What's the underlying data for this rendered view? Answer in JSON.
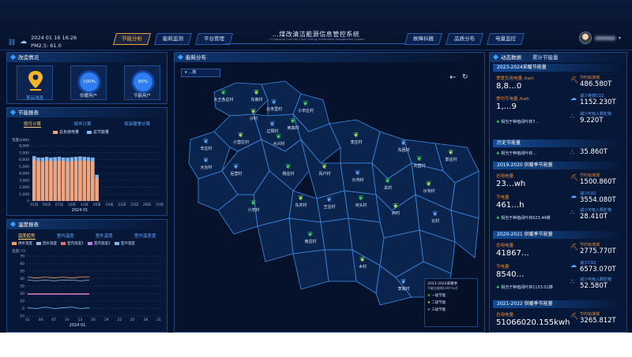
{
  "header": {
    "title": "…煤改清洁能源信息管控系统",
    "subtitle": "…t Changing Coal into Clean Energy Information Management System",
    "datetime": "2024 01 16 16:26",
    "pm25": "PM2.5: 61.0",
    "nav_left": [
      "节能分析",
      "能耗监测",
      "平台管理"
    ],
    "nav_right": [
      "故障抖搬",
      "品质分布",
      "电量监控"
    ],
    "active_nav": "节能分析"
  },
  "panels": {
    "reform": {
      "title": "改造情况",
      "tiles": [
        {
          "label": "首云改造",
          "value": ""
        },
        {
          "label": "供暖用户",
          "value": "100%"
        },
        {
          "label": "节能用户",
          "value": "80%"
        }
      ]
    },
    "energy_report": {
      "title": "节能报表",
      "tabs": [
        "按月计算",
        "按年计算",
        "按采暖季计算"
      ],
      "legend": [
        "总负荷电量",
        "总节能量"
      ],
      "ylabel": "电量(kWh)",
      "x_caption": "2024 01"
    },
    "temp_report": {
      "title": "温度报表",
      "tabs": [
        "温度趋势",
        "室内温度",
        "室外温度",
        "室内温差度"
      ],
      "legend": [
        "供水温度",
        "回水温度",
        "室内温度1",
        "室内温度2",
        "室外温度"
      ],
      "ylabel": "温度(℃)",
      "x_caption": "2024 01"
    },
    "map": {
      "title": "能耗分布",
      "select_label": "…煤",
      "legend_title": "2023-2024采暖季",
      "legend_subtitle": "节能总能耗(kW·h/㎡)",
      "legend_items": [
        "一级节能",
        "二级节能",
        "三级节能"
      ],
      "villages": [
        "大王各庄村",
        "东南村",
        "北寺里村",
        "小辛庄村",
        "沙村",
        "辽阳村",
        "西高村",
        "小营庄村",
        "辛庄村",
        "大兴村",
        "李庄村",
        "东团村",
        "刘营村",
        "郭庄村",
        "后营村",
        "杨庄村",
        "百户村",
        "沙鸿村",
        "关村",
        "沙沟村",
        "大台村",
        "小辛村",
        "东井村",
        "王庄村",
        "河头村",
        "西村",
        "北村",
        "南庄村",
        "木村",
        "李家村"
      ]
    },
    "right": {
      "tabs": [
        "动态数据",
        "累计节能量"
      ],
      "sections": [
        {
          "title": "2023-2024采暖节能量",
          "lines": [
            {
              "label": "季度负用电量 /kwh",
              "value": "8,8…0"
            },
            {
              "label": "季均节电量 /kwh",
              "value": "1,…9"
            }
          ],
          "tree_text": "相当于种植阔叶林7…",
          "right_items": [
            {
              "label": "节约标准煤",
              "value": "486.580T"
            },
            {
              "label": "减少排放CO2",
              "value": "1152.230T"
            },
            {
              "label": "减少可吸入颗粒物",
              "value": "9.220T"
            }
          ]
        },
        {
          "title": "历史节能量",
          "lines": [],
          "tree_text": "相当于种植阔叶林…",
          "right_items": [
            {
              "label": "",
              "value": "35.860T"
            }
          ]
        },
        {
          "title": "2019-2020 供暖季节能量",
          "lines": [
            {
              "label": "总用电量",
              "value": "23…wh"
            },
            {
              "label": "节电量",
              "value": "461…h"
            }
          ],
          "tree_text": "相当于种植阔叶林623.44棵",
          "right_items": [
            {
              "label": "节约标准煤",
              "value": "1500.860T"
            },
            {
              "label": "减少CO2",
              "value": "3554.080T"
            },
            {
              "label": "减少可吸入颗粒物",
              "value": "28.410T"
            }
          ]
        },
        {
          "title": "2020-2021 供暖季节能量",
          "lines": [
            {
              "label": "总用电量",
              "value": "41867…"
            },
            {
              "label": "节电量",
              "value": "8540…"
            }
          ],
          "tree_text": "相当于种植阔叶林1153.01棵",
          "right_items": [
            {
              "label": "节约标准煤",
              "value": "2775.770T"
            },
            {
              "label": "减少CO2",
              "value": "6573.070T"
            },
            {
              "label": "减少可吸入颗粒物",
              "value": "52.580T"
            }
          ]
        },
        {
          "title": "2021-2022 供暖季节能量",
          "lines": [
            {
              "label": "总用电量",
              "value": "51066020.155kwh"
            }
          ],
          "tree_text": "",
          "right_items": [
            {
              "label": "节约标准煤",
              "value": "3265.812T"
            }
          ]
        }
      ]
    }
  },
  "colors": {
    "accent": "#f0b24a",
    "primary": "#37a0ff",
    "orange": "#e58a3a",
    "bar_total": "#f2a57c",
    "bar_save": "#7fb7ef",
    "background": "#06122b"
  },
  "chart_data": [
    {
      "type": "bar",
      "title": "节能报表",
      "ylabel": "电量(kWh)",
      "categories": [
        "01",
        "02",
        "03",
        "04",
        "05",
        "06",
        "07",
        "08",
        "09",
        "10",
        "11",
        "12",
        "13",
        "14",
        "15",
        "16"
      ],
      "series": [
        {
          "name": "总负荷电量",
          "values": [
            6000,
            5800,
            5700,
            5900,
            5800,
            5750,
            5850,
            5800,
            5700,
            5750,
            5800,
            5900,
            5850,
            5800,
            5700,
            3400
          ]
        },
        {
          "name": "总节能量",
          "values": [
            6500,
            6300,
            6300,
            6400,
            6300,
            6350,
            6400,
            6300,
            6300,
            6350,
            6400,
            6450,
            6400,
            6350,
            6300,
            3800
          ]
        }
      ],
      "xticks": [
        "01日",
        "04日",
        "07日",
        "10日",
        "13日",
        "16日",
        "19日",
        "22日",
        "25日",
        "28日",
        "31日"
      ],
      "ylim": [
        0,
        8000
      ],
      "yticks": [
        "8,000",
        "7,000",
        "6,000",
        "5,000",
        "4,000",
        "3,000",
        "2,000",
        "1,000",
        "0"
      ],
      "grid": true
    },
    {
      "type": "line",
      "title": "温度报表",
      "ylabel": "温度(℃)",
      "xticks": [
        "01",
        "04",
        "07",
        "10",
        "13",
        "16",
        "19",
        "22",
        "25",
        "28",
        "31"
      ],
      "yticks": [
        "70",
        "60",
        "50",
        "40",
        "30",
        "20",
        "10",
        "0",
        "-10"
      ],
      "ylim": [
        -10,
        70
      ],
      "series": [
        {
          "name": "供水温度",
          "values": [
            42,
            41,
            42,
            41,
            42,
            41,
            42,
            42
          ]
        },
        {
          "name": "回水温度",
          "values": [
            38,
            37,
            38,
            37,
            38,
            38,
            37,
            38
          ]
        },
        {
          "name": "室内温度1",
          "values": [
            20,
            20,
            20,
            20,
            20,
            20,
            20,
            20
          ]
        },
        {
          "name": "室内温度2",
          "values": [
            19,
            19,
            19,
            19,
            19,
            19,
            19,
            19
          ]
        },
        {
          "name": "室外温度",
          "values": [
            1,
            0,
            2,
            0,
            1,
            2,
            0,
            1
          ]
        }
      ],
      "grid": true
    }
  ]
}
